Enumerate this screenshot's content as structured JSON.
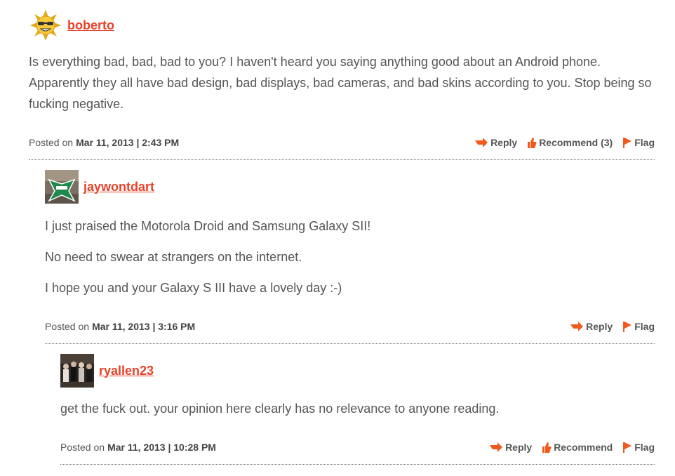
{
  "labels": {
    "posted_on": "Posted on",
    "reply": "Reply",
    "flag": "Flag"
  },
  "colors": {
    "accent": "#e8412a",
    "text": "#555555",
    "action_icon": "#f05a1c"
  },
  "comments": [
    {
      "username": "boberto",
      "avatar": "sun-with-sunglasses-avatar",
      "paragraphs": [
        "Is everything bad, bad, bad to you? I haven't heard you saying anything good about an Android phone. Apparently they all have bad design, bad displays, bad cameras, and bad skins according to you. Stop being so fucking negative."
      ],
      "date": "Mar 11, 2013 | 2:43 PM",
      "recommend_label": "Recommend (3)"
    },
    {
      "username": "jaywontdart",
      "avatar": "green-logo-avatar",
      "paragraphs": [
        "I just praised the Motorola Droid and Samsung Galaxy SII!",
        "No need to swear at strangers on the internet.",
        "I hope you and your Galaxy S III have a lovely day :-)"
      ],
      "date": "Mar 11, 2013 | 3:16 PM"
    },
    {
      "username": "ryallen23",
      "avatar": "band-photo-avatar",
      "paragraphs": [
        "get the fuck out. your opinion here clearly has no relevance to anyone reading."
      ],
      "date": "Mar 11, 2013 | 10:28 PM",
      "recommend_label": "Recommend"
    }
  ]
}
